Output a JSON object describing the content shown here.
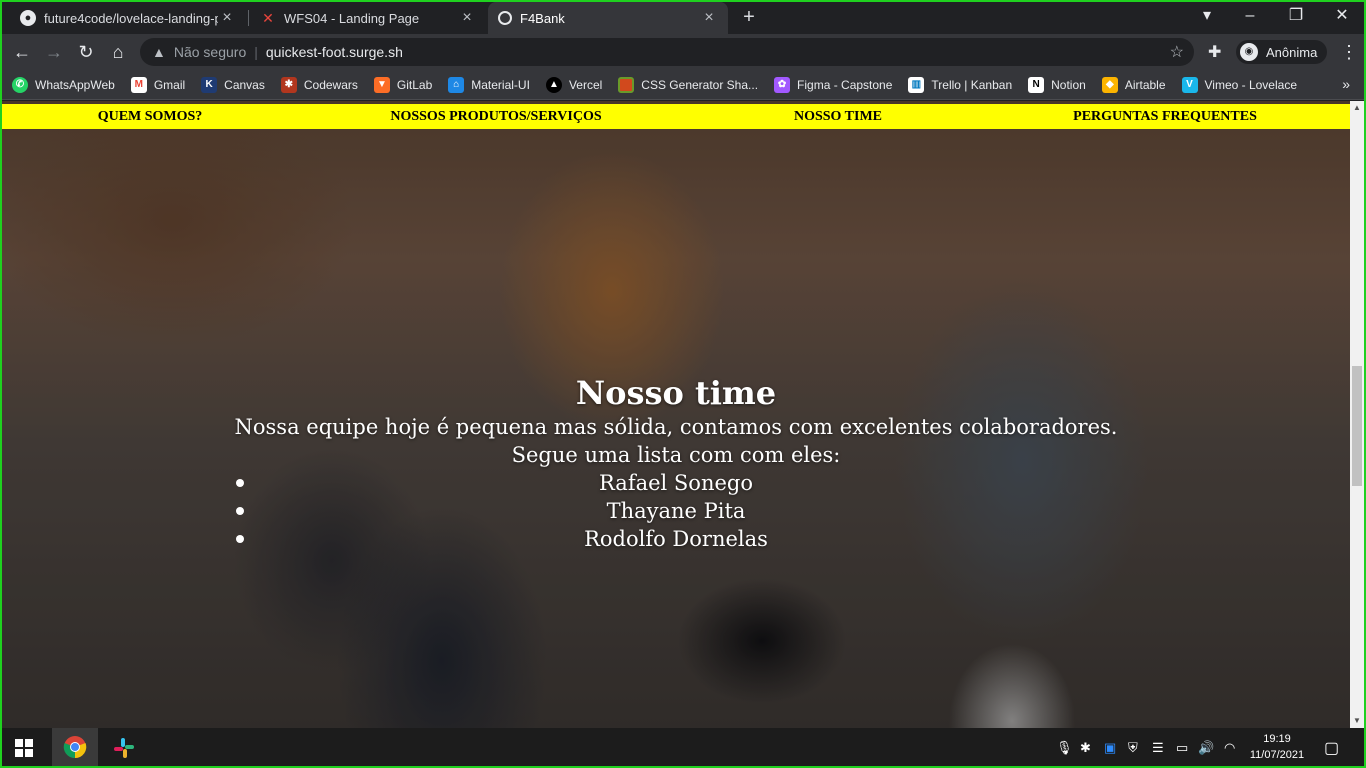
{
  "browser": {
    "tabs": [
      {
        "title": "future4code/lovelace-landing-pa",
        "icon": "github-icon"
      },
      {
        "title": "WFS04 - Landing Page",
        "icon": "wfs-icon"
      },
      {
        "title": "F4Bank",
        "icon": "globe-icon",
        "active": true
      }
    ],
    "omnibox": {
      "security_label": "Não seguro",
      "url": "quickest-foot.surge.sh"
    },
    "profile_label": "Anônima",
    "bookmarks": [
      {
        "label": "WhatsAppWeb",
        "icon": "whatsapp-icon",
        "color": "#25d366"
      },
      {
        "label": "Gmail",
        "icon": "gmail-icon",
        "color": "#ea4335"
      },
      {
        "label": "Canvas",
        "icon": "canvas-icon",
        "color": "#1f3b73"
      },
      {
        "label": "Codewars",
        "icon": "codewars-icon",
        "color": "#b1361e"
      },
      {
        "label": "GitLab",
        "icon": "gitlab-icon",
        "color": "#fc6d26"
      },
      {
        "label": "Material-UI",
        "icon": "material-ui-icon",
        "color": "#1e88e5"
      },
      {
        "label": "Vercel",
        "icon": "vercel-icon",
        "color": "#000000"
      },
      {
        "label": "CSS Generator Sha...",
        "icon": "css-generator-icon",
        "color": "#d1491d"
      },
      {
        "label": "Figma - Capstone",
        "icon": "figma-icon",
        "color": "#a259ff"
      },
      {
        "label": "Trello | Kanban",
        "icon": "trello-icon",
        "color": "#ffffff"
      },
      {
        "label": "Notion",
        "icon": "notion-icon",
        "color": "#ffffff"
      },
      {
        "label": "Airtable",
        "icon": "airtable-icon",
        "color": "#fcb400"
      },
      {
        "label": "Vimeo - Lovelace",
        "icon": "vimeo-icon",
        "color": "#1ab7ea"
      }
    ]
  },
  "page": {
    "nav": [
      "QUEM SOMOS?",
      "NOSSOS PRODUTOS/SERVIÇOS",
      "NOSSO TIME",
      "PERGUNTAS FREQUENTES"
    ],
    "nav_color": "#ffff00",
    "heading": "Nosso time",
    "intro": "Nossa equipe hoje é pequena mas sólida, contamos com excelentes colaboradores.",
    "list_intro": "Segue uma lista com com eles:",
    "team": [
      "Rafael Sonego",
      "Thayane Pita",
      "Rodolfo Dornelas"
    ]
  },
  "taskbar": {
    "time": "19:19",
    "date": "11/07/2021"
  }
}
